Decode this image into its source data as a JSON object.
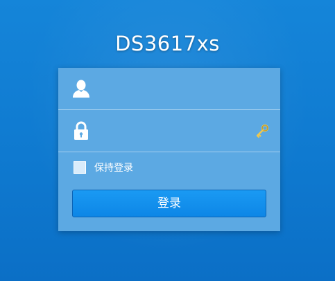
{
  "app": {
    "title": "DS3617xs"
  },
  "login_form": {
    "username": {
      "icon": "user-icon",
      "value": "",
      "placeholder": ""
    },
    "password": {
      "icon": "lock-icon",
      "value": "",
      "placeholder": "",
      "reveal_icon": "key-icon"
    },
    "remember_me": {
      "label": "保持登录",
      "checked": false
    },
    "submit_label": "登录"
  },
  "colors": {
    "background": "#0f7ad0",
    "panel": "#5ca9e3",
    "button": "#0d86e6",
    "key_icon": "#f2c84b"
  }
}
